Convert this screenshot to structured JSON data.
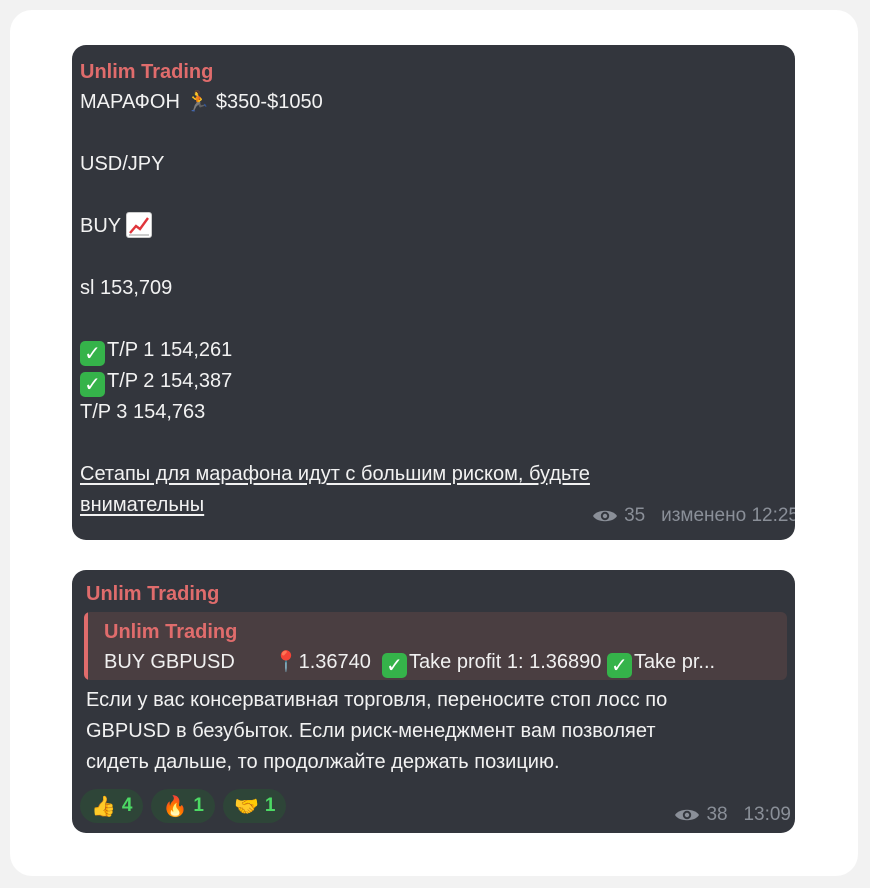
{
  "msg1": {
    "sender": "Unlim Trading",
    "title": "МАРАФОН",
    "title_emoji": "🏃",
    "title_range": "$350-$1050",
    "pair": "USD/JPY",
    "direction": "BUY",
    "direction_icon": "chart-increasing-icon",
    "sl": "sl 153,709",
    "tp1": "T/P 1 154,261",
    "tp2": "T/P 2 154,387",
    "tp3": "T/P 3 154,763",
    "warning_line1": "Сетапы для марафона идут с большим риском, будьте",
    "warning_line2": "внимательны",
    "views": "35",
    "edited_time": "изменено 12:25"
  },
  "msg2": {
    "sender": "Unlim Trading",
    "reply": {
      "sender": "Unlim Trading",
      "text_a": "BUY GBPUSD",
      "pin": "📍",
      "text_b": "1.36740",
      "text_c": "Take profit 1: 1.36890",
      "text_d": "Take pr..."
    },
    "body_line1": "Если у вас консервативная торговля, переносите стоп лосс по",
    "body_line2": "GBPUSD в безубыток. Если риск-менеджмент вам позволяет",
    "body_line3": "сидеть дальше, то продолжайте держать позицию.",
    "reactions": [
      {
        "icon": "👍",
        "count": "4"
      },
      {
        "icon": "🔥",
        "count": "1"
      },
      {
        "icon": "🤝",
        "count": "1"
      }
    ],
    "views": "38",
    "time": "13:09"
  },
  "colors": {
    "bubble": "#33363d",
    "sender": "#e06c6c",
    "meta": "#8a8f98",
    "reaction_bg": "#2e4538",
    "reaction_count": "#4cd964",
    "check": "#35b34a"
  }
}
